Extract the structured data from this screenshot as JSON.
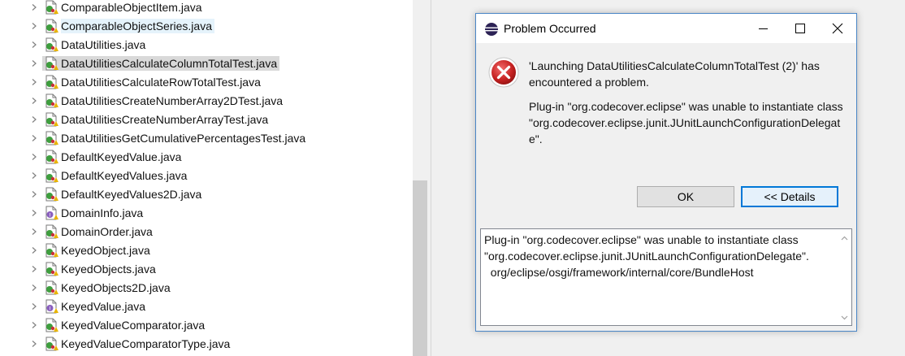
{
  "tree": {
    "items": [
      {
        "label": "ComparableObjectItem.java",
        "icon": "java-class-icon",
        "state": ""
      },
      {
        "label": "ComparableObjectSeries.java",
        "icon": "java-class-icon",
        "state": "hover"
      },
      {
        "label": "DataUtilities.java",
        "icon": "java-class-icon",
        "state": ""
      },
      {
        "label": "DataUtilitiesCalculateColumnTotalTest.java",
        "icon": "java-class-icon",
        "state": "selected"
      },
      {
        "label": "DataUtilitiesCalculateRowTotalTest.java",
        "icon": "java-class-icon",
        "state": ""
      },
      {
        "label": "DataUtilitiesCreateNumberArray2DTest.java",
        "icon": "java-class-icon",
        "state": ""
      },
      {
        "label": "DataUtilitiesCreateNumberArrayTest.java",
        "icon": "java-class-icon",
        "state": ""
      },
      {
        "label": "DataUtilitiesGetCumulativePercentagesTest.java",
        "icon": "java-class-icon",
        "state": ""
      },
      {
        "label": "DefaultKeyedValue.java",
        "icon": "java-class-icon",
        "state": ""
      },
      {
        "label": "DefaultKeyedValues.java",
        "icon": "java-class-icon",
        "state": ""
      },
      {
        "label": "DefaultKeyedValues2D.java",
        "icon": "java-class-icon",
        "state": ""
      },
      {
        "label": "DomainInfo.java",
        "icon": "java-interface-icon",
        "state": ""
      },
      {
        "label": "DomainOrder.java",
        "icon": "java-class-icon",
        "state": ""
      },
      {
        "label": "KeyedObject.java",
        "icon": "java-class-icon",
        "state": ""
      },
      {
        "label": "KeyedObjects.java",
        "icon": "java-class-icon",
        "state": ""
      },
      {
        "label": "KeyedObjects2D.java",
        "icon": "java-class-icon",
        "state": ""
      },
      {
        "label": "KeyedValue.java",
        "icon": "java-interface-icon",
        "state": ""
      },
      {
        "label": "KeyedValueComparator.java",
        "icon": "java-class-icon",
        "state": ""
      },
      {
        "label": "KeyedValueComparatorType.java",
        "icon": "java-class-icon",
        "state": ""
      }
    ]
  },
  "dialog": {
    "title": "Problem Occurred",
    "message": "'Launching DataUtilitiesCalculateColumnTotalTest (2)' has encountered a problem.",
    "detail_message": "Plug-in \"org.codecover.eclipse\" was unable to instantiate class \"org.codecover.eclipse.junit.JUnitLaunchConfigurationDelegate\".",
    "ok_label": "OK",
    "details_label": "<< Details",
    "details_text": "Plug-in \"org.codecover.eclipse\" was unable to instantiate class\n\"org.codecover.eclipse.junit.JUnitLaunchConfigurationDelegate\".\n  org/eclipse/osgi/framework/internal/core/BundleHost"
  },
  "colors": {
    "accent": "#0078d7",
    "error": "#d32f2f",
    "selection": "#d9d9d9",
    "hover": "#e5f3fb"
  }
}
